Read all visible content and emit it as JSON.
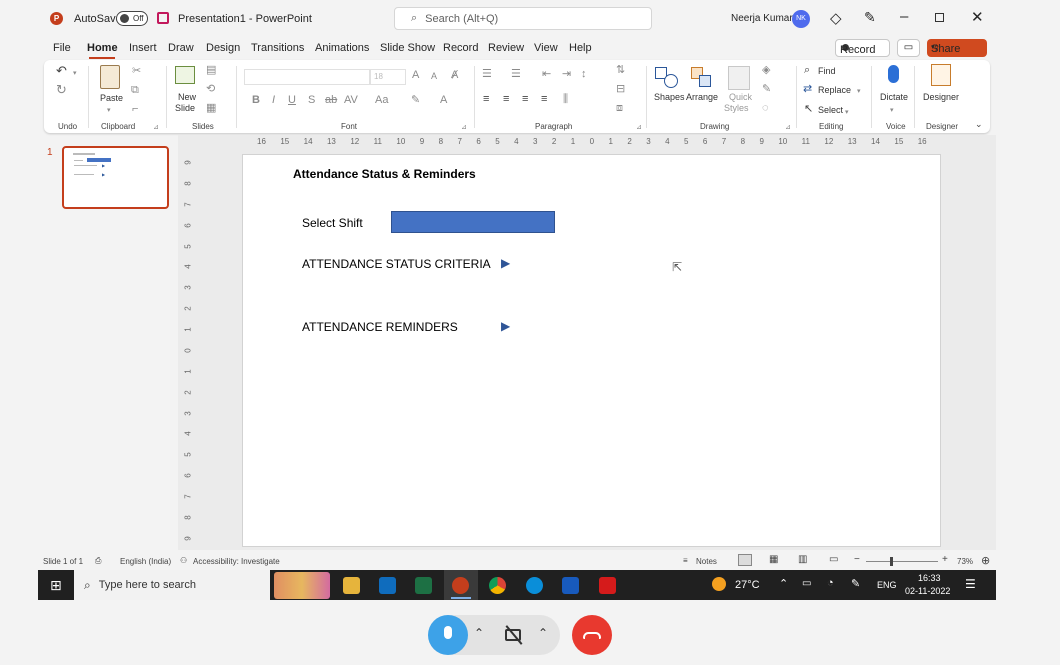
{
  "titlebar": {
    "autosave_label": "AutoSave",
    "autosave_state": "Off",
    "file_title": "Presentation1 - PowerPoint",
    "search_placeholder": "Search (Alt+Q)",
    "user_name": "Neerja Kumar",
    "user_initials": "NK"
  },
  "menu": {
    "items": [
      "File",
      "Home",
      "Insert",
      "Draw",
      "Design",
      "Transitions",
      "Animations",
      "Slide Show",
      "Record",
      "Review",
      "View",
      "Help"
    ],
    "active": "Home",
    "record_button": "Record",
    "share_button": "Share"
  },
  "ribbon": {
    "groups": {
      "undo": "Undo",
      "clipboard": "Clipboard",
      "slides": "Slides",
      "font": "Font",
      "paragraph": "Paragraph",
      "drawing": "Drawing",
      "editing": "Editing",
      "voice": "Voice",
      "designer": "Designer"
    },
    "paste": "Paste",
    "new_slide_1": "New",
    "new_slide_2": "Slide",
    "font_size": "18",
    "shapes": "Shapes",
    "arrange": "Arrange",
    "quick_styles_1": "Quick",
    "quick_styles_2": "Styles",
    "find": "Find",
    "replace": "Replace",
    "select": "Select",
    "dictate": "Dictate",
    "designer_btn": "Designer"
  },
  "thumbnails": [
    {
      "number": "1"
    }
  ],
  "ruler": {
    "horizontal": [
      "16",
      "15",
      "14",
      "13",
      "12",
      "11",
      "10",
      "9",
      "8",
      "7",
      "6",
      "5",
      "4",
      "3",
      "2",
      "1",
      "0",
      "1",
      "2",
      "3",
      "4",
      "5",
      "6",
      "7",
      "8",
      "9",
      "10",
      "11",
      "12",
      "13",
      "14",
      "15",
      "16"
    ],
    "vertical": [
      "9",
      "8",
      "7",
      "6",
      "5",
      "4",
      "3",
      "2",
      "1",
      "0",
      "1",
      "2",
      "3",
      "4",
      "5",
      "6",
      "7",
      "8",
      "9"
    ]
  },
  "slide": {
    "title": "Attendance Status & Reminders",
    "select_shift": "Select Shift",
    "shift_box_color": "#4472c4",
    "criteria": "ATTENDANCE STATUS CRITERIA",
    "reminders": "ATTENDANCE REMINDERS"
  },
  "statusbar": {
    "slide_of": "Slide 1 of 1",
    "language": "English (India)",
    "accessibility": "Accessibility: Investigate",
    "notes": "Notes",
    "zoom": "73%"
  },
  "taskbar": {
    "search_placeholder": "Type here to search",
    "weather": "27°C",
    "lang": "ENG",
    "time": "16:33",
    "date": "02-11-2022"
  },
  "colors": {
    "accent_orange": "#c43e1c",
    "share_bg": "#d04a1f",
    "hangup_red": "#e8392f",
    "mic_blue": "#3da2e8"
  }
}
